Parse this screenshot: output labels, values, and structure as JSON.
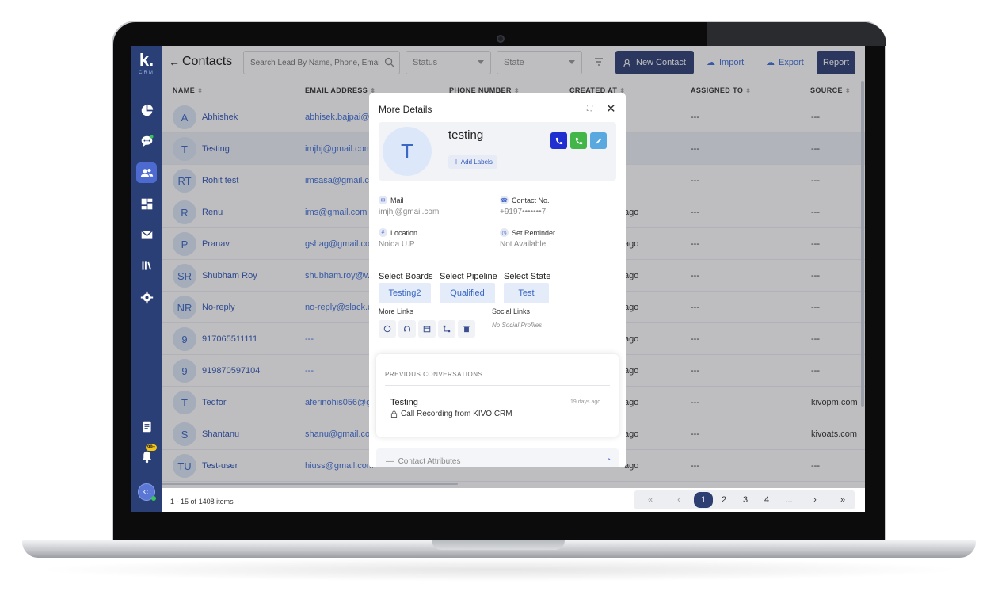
{
  "app": {
    "logo_letter": "k.",
    "logo_sub": "CRM",
    "notification_count": "99+",
    "user_initials": "KC"
  },
  "header": {
    "back": "←",
    "title": "Contacts",
    "search_placeholder": "Search Lead By Name, Phone, Email",
    "status_placeholder": "Status",
    "state_placeholder": "State",
    "new_contact": "New Contact",
    "import": "Import",
    "export": "Export",
    "report": "Report"
  },
  "columns": [
    "NAME",
    "EMAIL ADDRESS",
    "PHONE NUMBER",
    "CREATED AT",
    "ASSIGNED TO",
    "SOURCE"
  ],
  "rows": [
    {
      "initials": "A",
      "name": "Abhishek",
      "email": "abhisek.bajpai@w",
      "created": "",
      "assigned": "---",
      "source": "---"
    },
    {
      "initials": "T",
      "name": "Testing",
      "email": "imjhj@gmail.com",
      "created": "",
      "assigned": "---",
      "source": "---"
    },
    {
      "initials": "RT",
      "name": "Rohit test",
      "email": "imsasa@gmail.co",
      "created": "",
      "assigned": "---",
      "source": "---"
    },
    {
      "initials": "R",
      "name": "Renu",
      "email": "ims@gmail.com",
      "created": "ago",
      "assigned": "---",
      "source": "---"
    },
    {
      "initials": "P",
      "name": "Pranav",
      "email": "gshag@gmail.co",
      "created": "ago",
      "assigned": "---",
      "source": "---"
    },
    {
      "initials": "SR",
      "name": "Shubham Roy",
      "email": "shubham.roy@w3",
      "created": "ago",
      "assigned": "---",
      "source": "---"
    },
    {
      "initials": "NR",
      "name": "No-reply",
      "email": "no-reply@slack.c",
      "created": "ago",
      "assigned": "---",
      "source": "---"
    },
    {
      "initials": "9",
      "name": "917065511111",
      "email": "---",
      "created": "ago",
      "assigned": "---",
      "source": "---"
    },
    {
      "initials": "9",
      "name": "919870597104",
      "email": "---",
      "created": "ago",
      "assigned": "---",
      "source": "---"
    },
    {
      "initials": "T",
      "name": "Tedfor",
      "email": "aferinohis056@g",
      "created": "ago",
      "assigned": "---",
      "source": "kivopm.com"
    },
    {
      "initials": "S",
      "name": "Shantanu",
      "email": "shanu@gmail.cor",
      "created": "ago",
      "assigned": "---",
      "source": "kivoats.com"
    },
    {
      "initials": "TU",
      "name": "Test-user",
      "email": "hiuss@gmail.com",
      "created": "ago",
      "assigned": "---",
      "source": "---"
    }
  ],
  "footer": {
    "range": "1 - 15",
    "of_text": "of",
    "total": "1408",
    "items_text": "items",
    "pages": [
      "1",
      "2",
      "3",
      "4",
      "..."
    ],
    "first": "«",
    "prev": "‹",
    "next": "›",
    "last": "»"
  },
  "modal": {
    "title": "More Details",
    "avatar_letter": "T",
    "name": "testing",
    "add_labels": "Add Labels",
    "mail_label": "Mail",
    "mail_value": "imjhj@gmail.com",
    "contact_label": "Contact No.",
    "contact_value": "+9197•••••••7",
    "location_label": "Location",
    "location_value": "Noida U.P",
    "reminder_label": "Set Reminder",
    "reminder_value": "Not Available",
    "boards_label": "Select Boards",
    "boards_value": "Testing2",
    "pipeline_label": "Select Pipeline",
    "pipeline_value": "Qualified",
    "state_label": "Select State",
    "state_value": "Test",
    "more_links": "More Links",
    "social_links": "Social Links",
    "no_social": "No Social Profiles",
    "prev_conversations": "PREVIOUS CONVERSATIONS",
    "conv_name": "Testing",
    "conv_time": "19 days ago",
    "conv_text": "Call Recording from KIVO CRM",
    "attributes": "Contact Attributes",
    "colors": {
      "call_dark": "#1f2fd0",
      "whatsapp": "#43b649",
      "edit": "#5aa8e0"
    }
  }
}
